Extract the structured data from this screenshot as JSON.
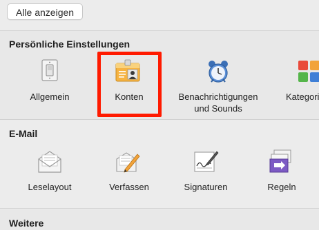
{
  "toolbar": {
    "show_all_label": "Alle anzeigen"
  },
  "sections": {
    "personal": {
      "title": "Persönliche Einstellungen",
      "items": [
        {
          "label": "Allgemein"
        },
        {
          "label": "Konten"
        },
        {
          "label_line1": "Benachrichtigungen",
          "label_line2": "und Sounds"
        },
        {
          "label": "Kategori"
        }
      ]
    },
    "email": {
      "title": "E-Mail",
      "items": [
        {
          "label": "Leselayout"
        },
        {
          "label": "Verfassen"
        },
        {
          "label": "Signaturen"
        },
        {
          "label": "Regeln"
        }
      ]
    },
    "other": {
      "title": "Weitere"
    }
  },
  "colors": {
    "highlight": "#ff1a00"
  }
}
